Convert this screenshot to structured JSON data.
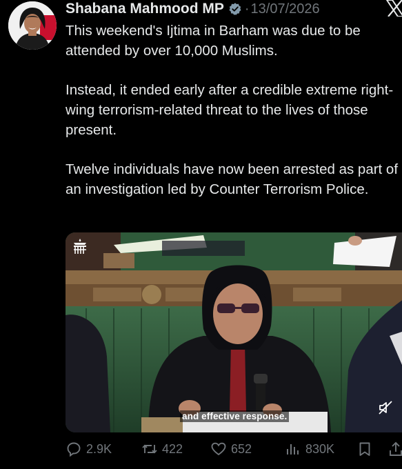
{
  "tweet": {
    "author_name": "Shabana Mahmood MP",
    "separator": "·",
    "date": "13/07/2026",
    "paragraphs": [
      "This weekend's Ijtima in Barham was due to be attended by over 10,000 Muslims.",
      "Instead, it ended early after a credible extreme right-wing terrorism-related threat to the lives of those present.",
      "Twelve individuals have now been arrested as part of an investigation led by Counter Terrorism Police."
    ]
  },
  "media": {
    "caption": "and effective response."
  },
  "actions": {
    "replies": "2.9K",
    "reposts": "422",
    "likes": "652",
    "views": "830K"
  },
  "icons": {
    "verified": "verified-badge-icon",
    "x_logo": "x-logo-icon",
    "crest": "portcullis-crest-icon",
    "mute": "mute-icon",
    "reply": "reply-icon",
    "repost": "repost-icon",
    "like": "heart-icon",
    "views": "views-icon",
    "bookmark": "bookmark-icon",
    "share": "share-icon"
  },
  "colors": {
    "background": "#000000",
    "text": "#e7e9ea",
    "muted": "#71767b",
    "verified_badge": "#829aab",
    "bench_green": "#2f5a3a"
  }
}
